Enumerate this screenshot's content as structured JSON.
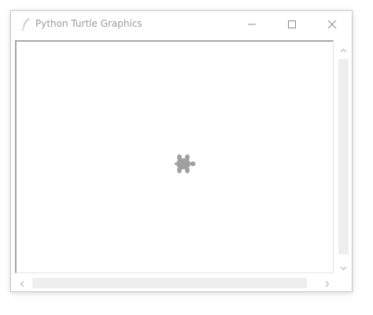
{
  "window": {
    "title": "Python Turtle Graphics",
    "app_icon": "feather-icon",
    "controls": {
      "minimize_icon": "minimize-icon",
      "maximize_icon": "maximize-icon",
      "close_icon": "close-icon"
    }
  },
  "canvas": {
    "background": "#ffffff",
    "turtle": {
      "shape": "turtle",
      "heading": "right",
      "color": "#a0a0a0"
    }
  },
  "scrollbars": {
    "vertical": {
      "up_icon": "chevron-up-icon",
      "down_icon": "chevron-down-icon"
    },
    "horizontal": {
      "left_icon": "chevron-left-icon",
      "right_icon": "chevron-right-icon"
    }
  },
  "colors": {
    "title_text": "#9a9a9a",
    "window_border": "#c9c9c9",
    "scroll_thumb": "#eeeeee",
    "canvas_inset_border": "#a8a8a8"
  }
}
